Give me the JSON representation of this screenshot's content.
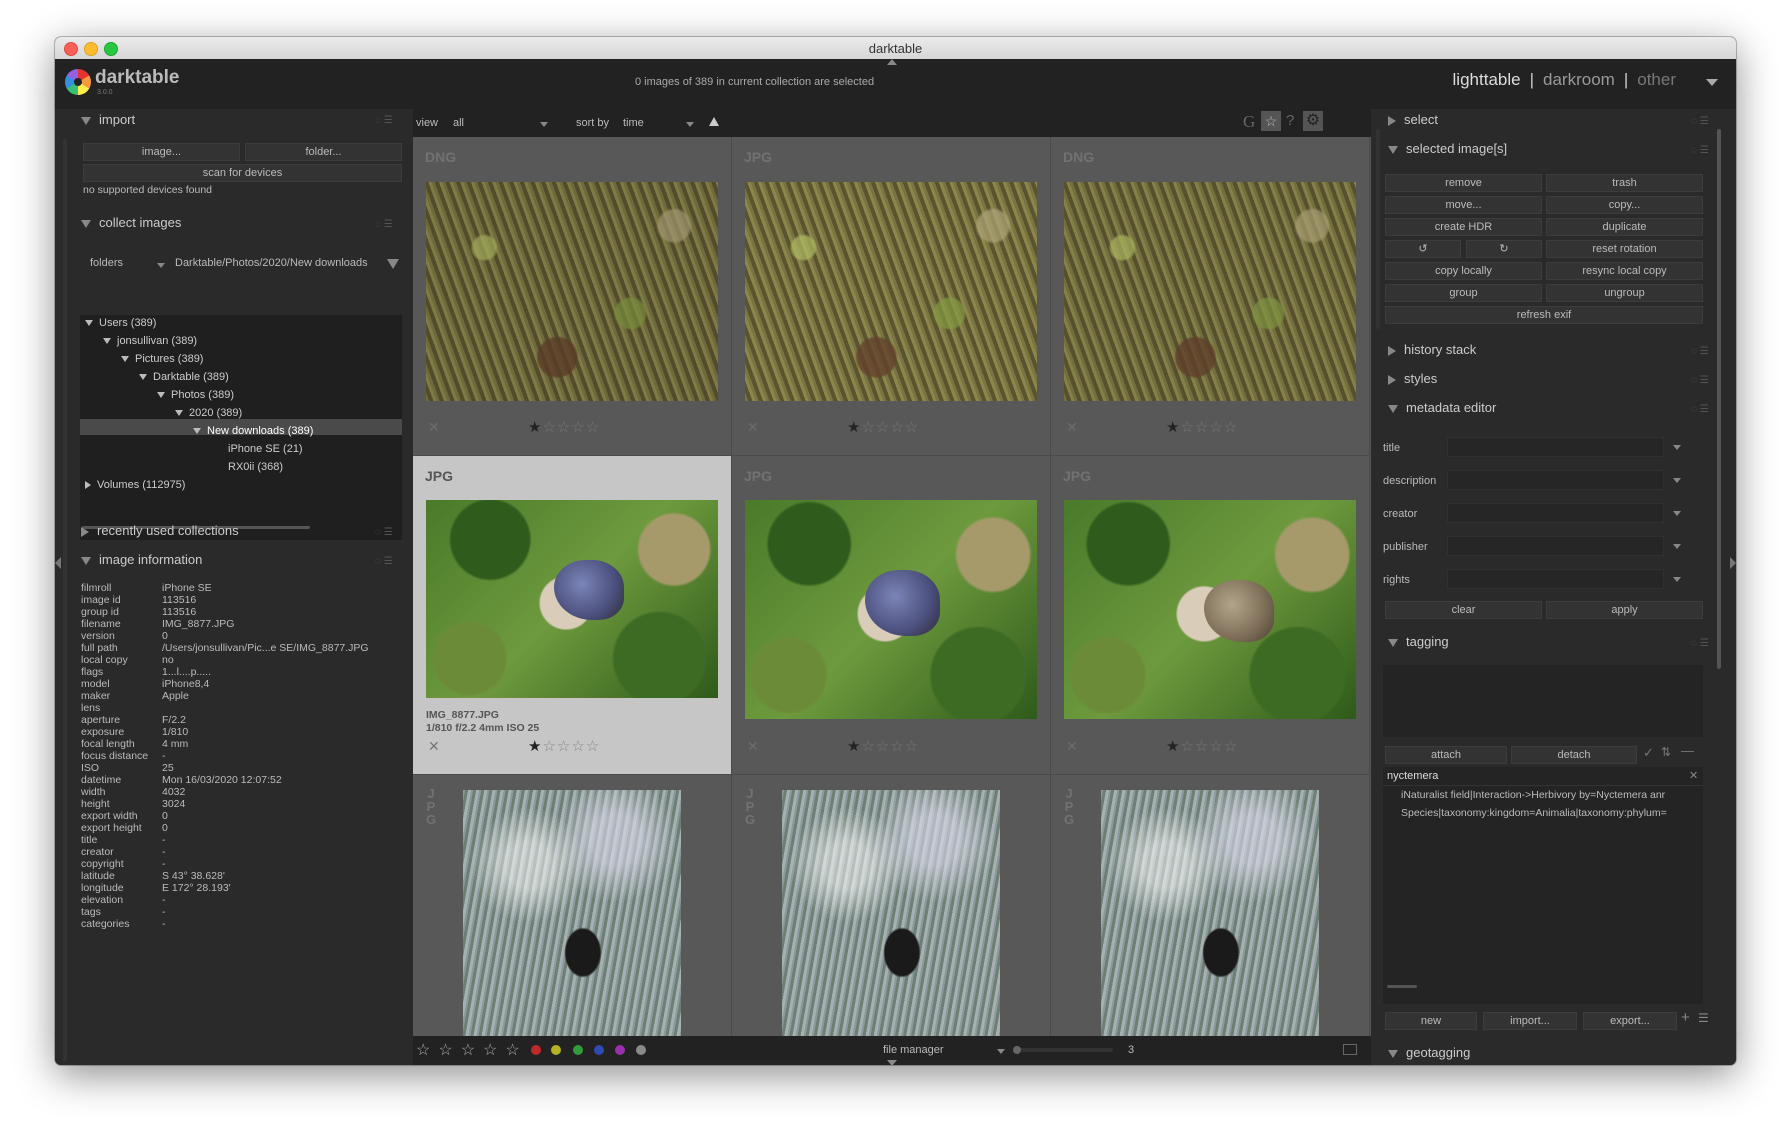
{
  "window": {
    "title": "darktable"
  },
  "app": {
    "name": "darktable",
    "version": "3.0.0",
    "status": "0 images of 389 in current collection are selected"
  },
  "views": {
    "lighttable": "lighttable",
    "sep1": "|",
    "darkroom": "darkroom",
    "sep2": "|",
    "other": "other"
  },
  "left": {
    "import": {
      "title": "import",
      "image_btn": "image...",
      "folder_btn": "folder...",
      "scan_btn": "scan for devices",
      "status": "no supported devices found"
    },
    "collect": {
      "title": "collect images",
      "criterion": "folders",
      "path": "Darktable/Photos/2020/New downloads",
      "tree": [
        "Users (389)",
        "jonsullivan (389)",
        "Pictures (389)",
        "Darktable (389)",
        "Photos (389)",
        "2020 (389)",
        "New downloads (389)",
        "iPhone SE (21)",
        "RX0ii (368)",
        "Volumes (112975)"
      ]
    },
    "recent": {
      "title": "recently used collections"
    },
    "info": {
      "title": "image information",
      "labels": [
        "filmroll",
        "image id",
        "group id",
        "filename",
        "version",
        "full path",
        "local copy",
        "flags",
        "model",
        "maker",
        "lens",
        "aperture",
        "exposure",
        "focal length",
        "focus distance",
        "ISO",
        "datetime",
        "width",
        "height",
        "export width",
        "export height",
        "title",
        "creator",
        "copyright",
        "latitude",
        "longitude",
        "elevation",
        "tags",
        "categories"
      ],
      "values": [
        "iPhone SE",
        "113516",
        "113516",
        "IMG_8877.JPG",
        "0",
        "/Users/jonsullivan/Pic...e SE/IMG_8877.JPG",
        "no",
        "1...l....p.....",
        "iPhone8,4",
        "Apple",
        "",
        "F/2.2",
        "1/810",
        "4 mm",
        "-",
        "25",
        "Mon 16/03/2020 12:07:52",
        "4032",
        "3024",
        "0",
        "0",
        "-",
        "-",
        "-",
        "S 43° 38.628'",
        "E 172° 28.193'",
        "-",
        "-",
        "-"
      ]
    }
  },
  "toolbar": {
    "view_label": "view",
    "view_value": "all",
    "sort_label": "sort by",
    "sort_value": "time"
  },
  "grid": {
    "cells": [
      {
        "ext": "DNG",
        "caption1": "",
        "caption2": ""
      },
      {
        "ext": "JPG",
        "caption1": "",
        "caption2": ""
      },
      {
        "ext": "DNG",
        "caption1": "",
        "caption2": ""
      },
      {
        "ext": "JPG",
        "caption1": "IMG_8877.JPG",
        "caption2": "1/810 f/2.2 4mm ISO 25"
      },
      {
        "ext": "JPG",
        "caption1": "",
        "caption2": ""
      },
      {
        "ext": "JPG",
        "caption1": "",
        "caption2": ""
      },
      {
        "ext": "J\nP\nG",
        "caption1": "",
        "caption2": ""
      },
      {
        "ext": "J\nP\nG",
        "caption1": "",
        "caption2": ""
      },
      {
        "ext": "J\nP\nG",
        "caption1": "",
        "caption2": ""
      }
    ],
    "rating": 1
  },
  "bottom": {
    "layout": "file manager",
    "zoom": "3",
    "colors": [
      "#c0282b",
      "#b5b226",
      "#2f9e3a",
      "#2f4bb0",
      "#9a2fb0",
      "#8a8a8a"
    ]
  },
  "right": {
    "select": {
      "title": "select"
    },
    "selected": {
      "title": "selected image[s]",
      "buttons": [
        "remove",
        "trash",
        "move...",
        "copy...",
        "create HDR",
        "duplicate",
        "reset rotation",
        "copy locally",
        "resync local copy",
        "group",
        "ungroup",
        "refresh exif"
      ]
    },
    "history": {
      "title": "history stack"
    },
    "styles": {
      "title": "styles"
    },
    "metadata": {
      "title": "metadata editor",
      "fields": [
        "title",
        "description",
        "creator",
        "publisher",
        "rights"
      ],
      "clear": "clear",
      "apply": "apply"
    },
    "tagging": {
      "title": "tagging",
      "attach": "attach",
      "detach": "detach",
      "entry": "nyctemera",
      "suggestions": [
        "iNaturalist field|Interaction->Herbivory by=Nyctemera anr",
        "Species|taxonomy:kingdom=Animalia|taxonomy:phylum="
      ],
      "new": "new",
      "import": "import...",
      "export": "export..."
    },
    "geotagging": {
      "title": "geotagging"
    }
  }
}
